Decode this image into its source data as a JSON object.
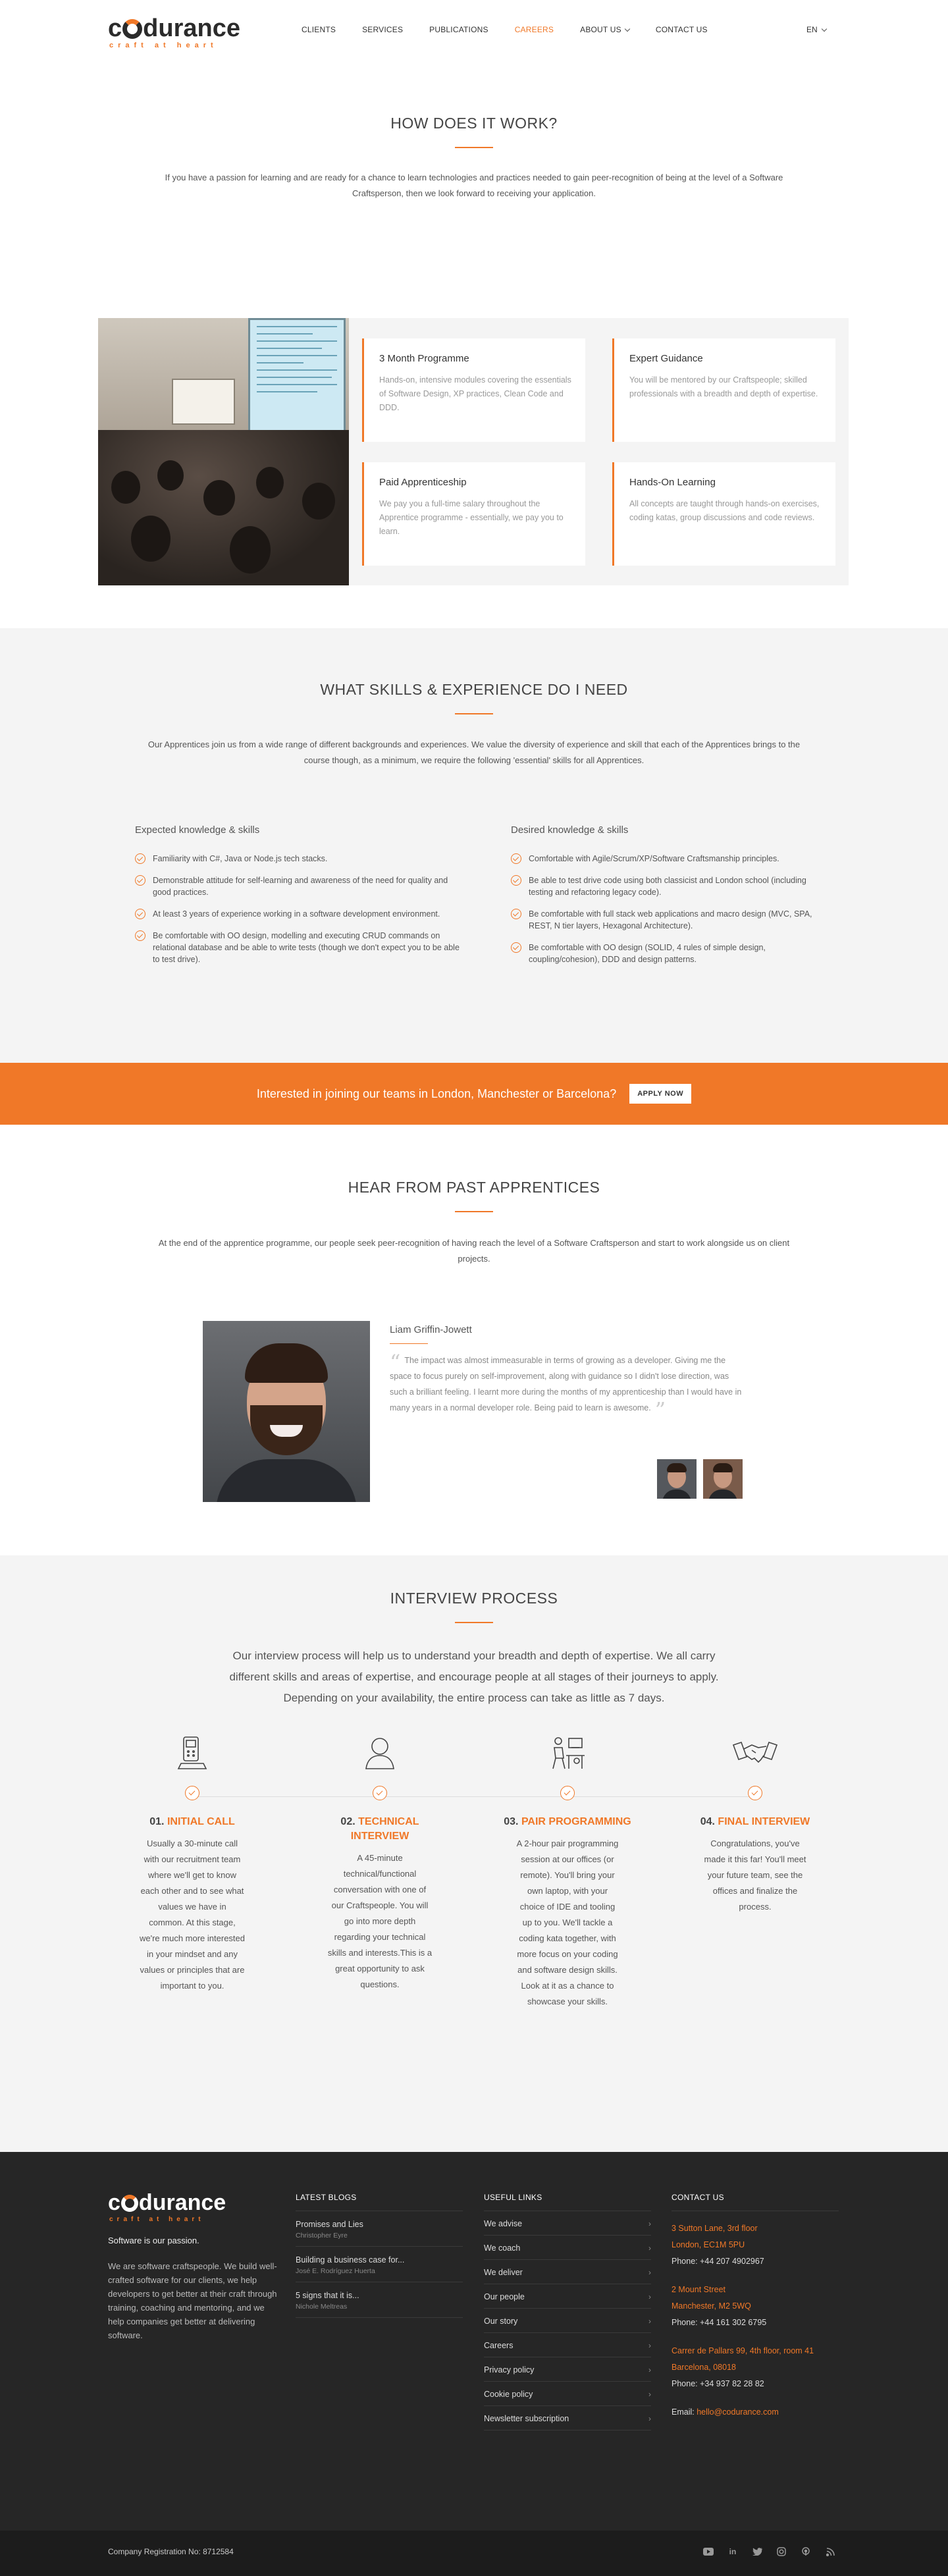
{
  "header": {
    "logo_text_1": "c",
    "logo_text_2": "durance",
    "logo_tagline": "craft at heart",
    "nav": [
      {
        "label": "CLIENTS"
      },
      {
        "label": "SERVICES"
      },
      {
        "label": "PUBLICATIONS"
      },
      {
        "label": "CAREERS"
      },
      {
        "label": "ABOUT US"
      },
      {
        "label": "CONTACT US"
      }
    ],
    "lang": "EN",
    "accent": "#f07828"
  },
  "how": {
    "title": "HOW DOES IT WORK?",
    "lead": "If you have a passion for learning and are ready for a chance to learn technologies and practices needed to gain peer-recognition of being at the level of a Software Craftsperson, then we look forward to receiving your application.",
    "cards": [
      {
        "title": "3 Month Programme",
        "text": "Hands-on, intensive modules covering the essentials of Software Design, XP practices, Clean Code and DDD."
      },
      {
        "title": "Expert Guidance",
        "text": "You will be mentored by our Craftspeople; skilled professionals with a breadth and depth of expertise."
      },
      {
        "title": "Paid Apprenticeship",
        "text": "We pay you a full-time salary throughout the Apprentice programme - essentially, we pay you to learn."
      },
      {
        "title": "Hands-On Learning",
        "text": "All concepts are taught through hands-on exercises, coding katas, group discussions and code reviews."
      }
    ]
  },
  "skills": {
    "title": "WHAT SKILLS & EXPERIENCE DO I NEED",
    "lead": "Our Apprentices join us from a wide range of different backgrounds and experiences. We value the diversity of experience and skill that each of the Apprentices brings to the course though, as a minimum, we require the following 'essential' skills for all Apprentices.",
    "expected_title": "Expected knowledge & skills",
    "expected": [
      "Familiarity with C#, Java or Node.js tech stacks.",
      "Demonstrable attitude for self-learning and awareness of the need for quality and good practices.",
      "At least 3 years of experience working in a software development environment.",
      "Be comfortable with OO design, modelling and executing CRUD commands on relational database and be able to write tests (though we don't expect you to be able to test drive)."
    ],
    "desired_title": "Desired knowledge & skills",
    "desired": [
      "Comfortable with Agile/Scrum/XP/Software Craftsmanship principles.",
      "Be able to test drive code using both classicist and London school (including testing and refactoring legacy code).",
      "Be comfortable with full stack web applications and macro design (MVC, SPA, REST, N tier layers, Hexagonal Architecture).",
      "Be comfortable with OO design (SOLID, 4 rules of simple design, coupling/cohesion), DDD and design patterns."
    ]
  },
  "banner": {
    "text": "Interested in joining our teams in London, Manchester or Barcelona?",
    "button": "APPLY NOW"
  },
  "past": {
    "title": "HEAR FROM PAST APPRENTICES",
    "lead": "At the end of the apprentice programme, our people seek peer-recognition of having reach the level of a Software Craftsperson and start to work alongside us on client projects.",
    "name": "Liam Griffin-Jowett",
    "quote": "The impact was almost immeasurable in terms of growing as a developer. Giving me the space to focus purely on self-improvement, along with guidance so I didn't lose direction, was such a brilliant feeling. I learnt more during the months of my apprenticeship than I would have in many years in a normal developer role. Being paid to learn is awesome."
  },
  "interview": {
    "title": "INTERVIEW PROCESS",
    "lead": "Our interview process will help us to understand your breadth and depth of expertise. We all carry different skills and areas of expertise, and encourage people at all stages of their journeys to apply. Depending on your availability, the entire process can take as little as 7 days.",
    "steps": [
      {
        "num": "01.",
        "title": "INITIAL CALL",
        "icon": "phone-icon",
        "text": "Usually a 30-minute call with our recruitment team where we'll get to know each other and to see what values we have in common. At this stage, we're much more interested in your mindset and any values or principles that are important to you."
      },
      {
        "num": "02.",
        "title": "TECHNICAL INTERVIEW",
        "icon": "person-icon",
        "text": "A 45-minute technical/functional conversation with one of our Craftspeople. You will go into more depth regarding your technical skills and interests.This is a great opportunity to ask questions."
      },
      {
        "num": "03.",
        "title": "PAIR PROGRAMMING",
        "icon": "pair-desk-icon",
        "text": "A 2-hour pair programming session at our offices (or remote). You'll bring your own laptop, with your choice of IDE and tooling up to you. We'll tackle a coding kata together, with more focus on your coding and software design skills. Look at it as a chance to showcase your skills."
      },
      {
        "num": "04.",
        "title": "FINAL INTERVIEW",
        "icon": "handshake-icon",
        "text": "Congratulations, you've made it this far! You'll meet your future team, see the offices and finalize the process."
      }
    ]
  },
  "footer": {
    "tagline": "Software is our passion.",
    "about": "We are software craftspeople. We build well-crafted software for our clients, we help developers to get better at their craft through training, coaching and mentoring, and we help companies get better at delivering software.",
    "blogs_title": "LATEST BLOGS",
    "blogs": [
      {
        "title": "Promises and Lies",
        "author": "Christopher Eyre"
      },
      {
        "title": "Building a business case for...",
        "author": "José E. Rodríguez Huerta"
      },
      {
        "title": "5 signs that it is...",
        "author": "Nichole Meltreas"
      }
    ],
    "links_title": "USEFUL LINKS",
    "links": [
      "We advise",
      "We coach",
      "We deliver",
      "Our people",
      "Our story",
      "Careers",
      "Privacy policy",
      "Cookie policy",
      "Newsletter subscription"
    ],
    "contact_title": "CONTACT US",
    "london_1": "3 Sutton Lane, 3rd floor",
    "london_2": "London, EC1M 5PU",
    "london_phone": "Phone: +44 207 4902967",
    "manchester_1": "2 Mount Street",
    "manchester_2": "Manchester, M2 5WQ",
    "manchester_phone": "Phone: +44 161 302 6795",
    "barcelona_1": "Carrer de Pallars 99, 4th floor, room 41",
    "barcelona_2": "Barcelona, 08018",
    "barcelona_phone": "Phone: +34 937 82 28 82",
    "email_label": "Email: ",
    "email": "hello@codurance.com",
    "registration": "Company Registration No: 8712584",
    "socials": [
      "youtube-icon",
      "linkedin-icon",
      "twitter-icon",
      "instagram-icon",
      "podcast-icon",
      "rss-icon"
    ]
  }
}
